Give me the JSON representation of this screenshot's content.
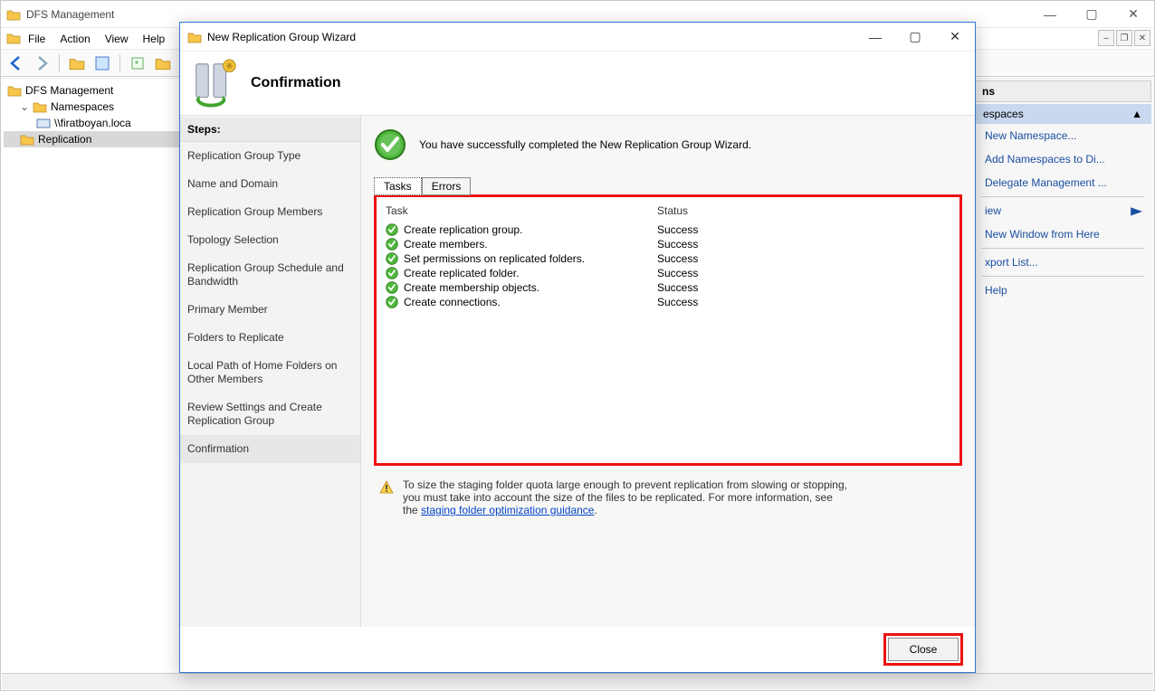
{
  "parent": {
    "title": "DFS Management",
    "menu": {
      "file": "File",
      "action": "Action",
      "view": "View",
      "help": "Help"
    }
  },
  "tree": {
    "root": "DFS Management",
    "namespaces": "Namespaces",
    "ns_child": "\\\\firatboyan.loca",
    "replication": "Replication"
  },
  "actions": {
    "header": "ns",
    "group": "espaces",
    "items": {
      "new_ns": "New Namespace...",
      "add_ns": "Add Namespaces to Di...",
      "delegate": "Delegate Management ...",
      "view": "iew",
      "new_window": "New Window from Here",
      "export": "xport List...",
      "help": "Help"
    }
  },
  "dialog": {
    "title": "New Replication Group Wizard",
    "heading": "Confirmation",
    "steps_label": "Steps:",
    "steps": [
      "Replication Group Type",
      "Name and Domain",
      "Replication Group Members",
      "Topology Selection",
      "Replication Group Schedule and Bandwidth",
      "Primary Member",
      "Folders to Replicate",
      "Local Path of Home Folders on Other Members",
      "Review Settings and Create Replication Group",
      "Confirmation"
    ],
    "success_msg": "You have successfully completed the New Replication Group Wizard.",
    "tabs": {
      "tasks": "Tasks",
      "errors": "Errors"
    },
    "columns": {
      "task": "Task",
      "status": "Status"
    },
    "tasks": [
      {
        "name": "Create replication group.",
        "status": "Success"
      },
      {
        "name": "Create members.",
        "status": "Success"
      },
      {
        "name": "Set permissions on replicated folders.",
        "status": "Success"
      },
      {
        "name": "Create replicated folder.",
        "status": "Success"
      },
      {
        "name": "Create membership objects.",
        "status": "Success"
      },
      {
        "name": "Create connections.",
        "status": "Success"
      }
    ],
    "info_text": "To size the staging folder quota large enough to prevent replication from slowing or stopping, you must take into account the size of the files to be replicated. For more information, see the ",
    "info_link": "staging folder optimization guidance",
    "info_period": ".",
    "close": "Close"
  }
}
